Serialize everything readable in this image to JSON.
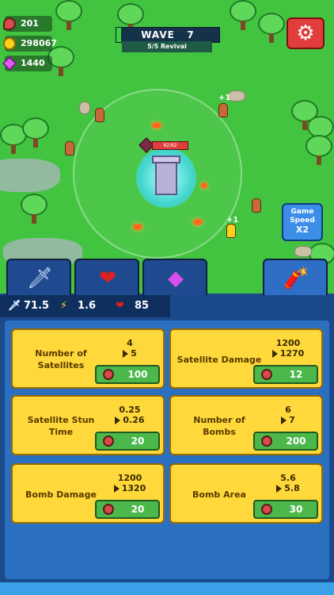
{
  "resources": {
    "meat": "201",
    "coins": "298067",
    "gems": "1440"
  },
  "wave": {
    "label": "WAVE",
    "number": "7",
    "revival": "5/5 Revival"
  },
  "tower": {
    "hp_label": "82/82"
  },
  "floating_text": "+1",
  "speed_button": {
    "line1": "Game",
    "line2": "Speed",
    "multiplier": "X2"
  },
  "tabs": [
    {
      "icon": "sword-icon",
      "glyph": "🗡"
    },
    {
      "icon": "heart-icon",
      "glyph": "❤"
    },
    {
      "icon": "gem-icon",
      "glyph": "◆"
    },
    {
      "icon": "dynamite-icon",
      "glyph": "🧨"
    }
  ],
  "stats": {
    "attack": "71.5",
    "speed": "1.6",
    "health": "85"
  },
  "upgrades": [
    {
      "name": "Number of Satellites",
      "current": "4",
      "next": "5",
      "cost": "100"
    },
    {
      "name": "Satellite Damage",
      "current": "1200",
      "next": "1270",
      "cost": "12"
    },
    {
      "name": "Satellite Stun Time",
      "current": "0.25",
      "next": "0.26",
      "cost": "20"
    },
    {
      "name": "Number of Bombs",
      "current": "6",
      "next": "7",
      "cost": "200"
    },
    {
      "name": "Bomb Damage",
      "current": "1200",
      "next": "1320",
      "cost": "20"
    },
    {
      "name": "Bomb Area",
      "current": "5.6",
      "next": "5.8",
      "cost": "30"
    }
  ],
  "colors": {
    "field": "#43c441",
    "panel": "#1a4a8a",
    "card": "#ffd93b",
    "buy": "#4cb84c",
    "settings": "#e23d3d"
  }
}
